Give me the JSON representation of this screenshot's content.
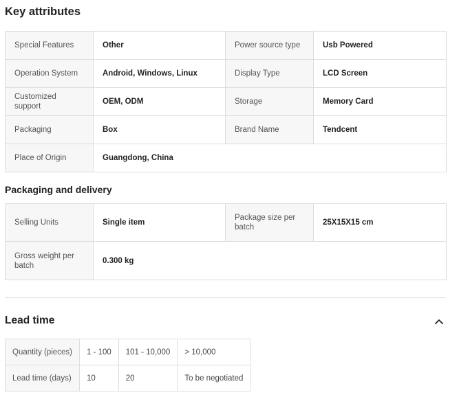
{
  "key_attributes": {
    "title": "Key attributes",
    "rows": [
      [
        {
          "label": "Special Features",
          "value": "Other"
        },
        {
          "label": "Power source type",
          "value": "Usb Powered"
        }
      ],
      [
        {
          "label": "Operation System",
          "value": "Android, Windows, Linux"
        },
        {
          "label": "Display Type",
          "value": "LCD Screen"
        }
      ],
      [
        {
          "label": "Customized support",
          "value": "OEM, ODM"
        },
        {
          "label": "Storage",
          "value": "Memory Card"
        }
      ],
      [
        {
          "label": "Packaging",
          "value": "Box"
        },
        {
          "label": "Brand Name",
          "value": "Tendcent"
        }
      ],
      [
        {
          "label": "Place of Origin",
          "value": "Guangdong, China"
        }
      ]
    ]
  },
  "packaging": {
    "title": "Packaging and delivery",
    "rows": [
      [
        {
          "label": "Selling Units",
          "value": "Single item"
        },
        {
          "label": "Package size per batch",
          "value": "25X15X15 cm"
        }
      ],
      [
        {
          "label": "Gross weight per batch",
          "value": "0.300 kg"
        }
      ]
    ]
  },
  "lead_time": {
    "title": "Lead time",
    "toggle_icon": "chevron-up-icon",
    "quantity_label": "Quantity (pieces)",
    "quantities": [
      "1 - 100",
      "101 - 10,000",
      "> 10,000"
    ],
    "days_label": "Lead time (days)",
    "days": [
      "10",
      "20",
      "To be negotiated"
    ]
  }
}
